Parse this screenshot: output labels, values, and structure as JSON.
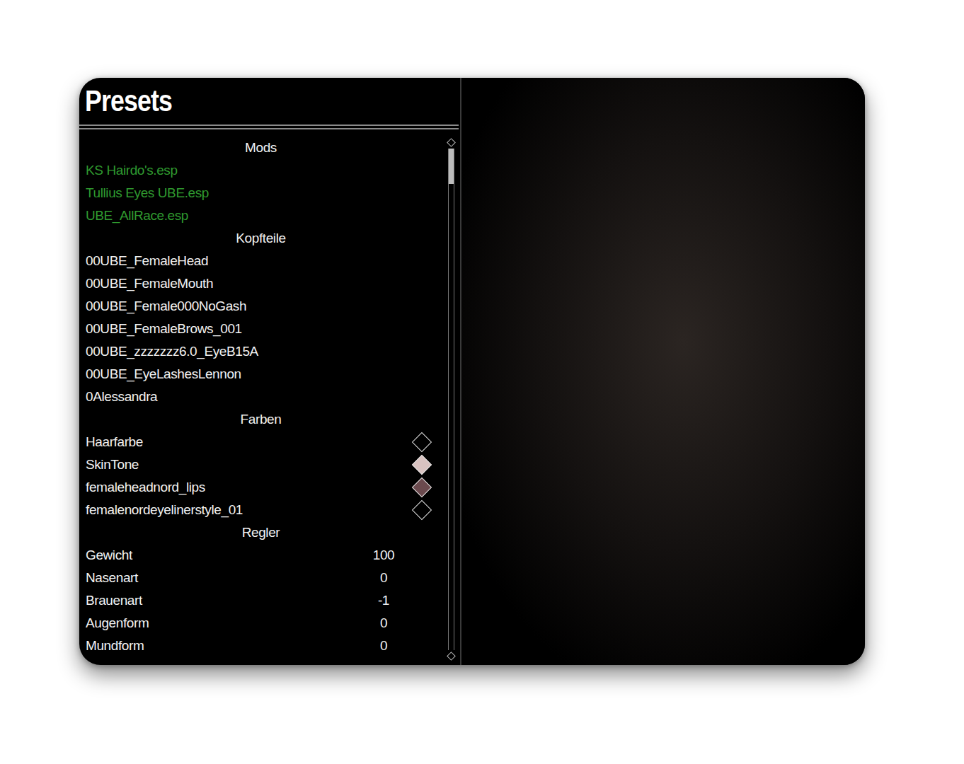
{
  "title": "Presets",
  "sections": [
    {
      "title": "Mods",
      "items": [
        {
          "kind": "mod",
          "label": "KS Hairdo's.esp"
        },
        {
          "kind": "mod",
          "label": "Tullius Eyes UBE.esp"
        },
        {
          "kind": "mod",
          "label": "UBE_AllRace.esp"
        }
      ]
    },
    {
      "title": "Kopfteile",
      "items": [
        {
          "kind": "part",
          "label": "00UBE_FemaleHead"
        },
        {
          "kind": "part",
          "label": "00UBE_FemaleMouth"
        },
        {
          "kind": "part",
          "label": "00UBE_Female000NoGash"
        },
        {
          "kind": "part",
          "label": "00UBE_FemaleBrows_001"
        },
        {
          "kind": "part",
          "label": "00UBE_zzzzzzz6.0_EyeB15A"
        },
        {
          "kind": "part",
          "label": "00UBE_EyeLashesLennon"
        },
        {
          "kind": "part",
          "label": "0Alessandra"
        }
      ]
    },
    {
      "title": "Farben",
      "items": [
        {
          "kind": "color",
          "label": "Haarfarbe",
          "color": "#000000"
        },
        {
          "kind": "color",
          "label": "SkinTone",
          "color": "#d9c3c1"
        },
        {
          "kind": "color",
          "label": "femaleheadnord_lips",
          "color": "#6b4a4e"
        },
        {
          "kind": "color",
          "label": "femalenordeyelinerstyle_01",
          "color": "#000000"
        }
      ]
    },
    {
      "title": "Regler",
      "items": [
        {
          "kind": "slider",
          "label": "Gewicht",
          "value": "100"
        },
        {
          "kind": "slider",
          "label": "Nasenart",
          "value": "0"
        },
        {
          "kind": "slider",
          "label": "Brauenart",
          "value": "-1"
        },
        {
          "kind": "slider",
          "label": "Augenform",
          "value": "0"
        },
        {
          "kind": "slider",
          "label": "Mundform",
          "value": "0"
        }
      ]
    }
  ],
  "scrollbar": {
    "position": 0,
    "level": 0.07
  }
}
